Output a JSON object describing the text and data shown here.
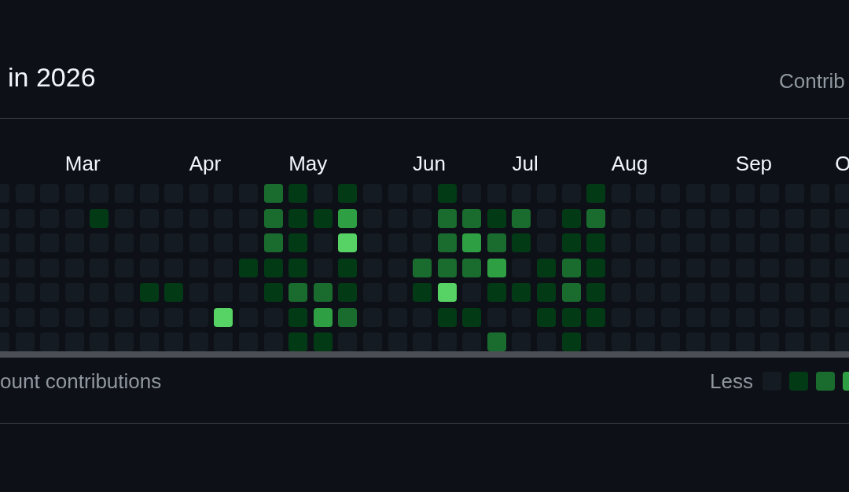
{
  "title": "in 2026",
  "settings_label": "Contrib",
  "weeks": [
    {
      "days": [
        {
          "color": "#151b23"
        },
        {
          "color": "#151b23"
        },
        {
          "color": "#151b23"
        },
        {
          "color": "#151b23"
        },
        {
          "color": "#151b23"
        },
        {
          "color": "#151b23"
        },
        {
          "color": "#151b23"
        }
      ]
    },
    {
      "days": [
        {
          "color": "#151b23"
        },
        {
          "color": "#151b23"
        },
        {
          "color": "#151b23"
        },
        {
          "color": "#151b23"
        },
        {
          "color": "#151b23"
        },
        {
          "color": "#151b23"
        },
        {
          "color": "#151b23"
        }
      ]
    },
    {
      "days": [
        {
          "color": "#151b23"
        },
        {
          "color": "#151b23"
        },
        {
          "color": "#151b23"
        },
        {
          "color": "#151b23"
        },
        {
          "color": "#151b23"
        },
        {
          "color": "#151b23"
        },
        {
          "color": "#151b23"
        }
      ]
    },
    {
      "month": "Mar",
      "days": [
        {
          "color": "#151b23"
        },
        {
          "color": "#151b23"
        },
        {
          "color": "#151b23"
        },
        {
          "color": "#151b23"
        },
        {
          "color": "#151b23"
        },
        {
          "color": "#151b23"
        },
        {
          "color": "#151b23"
        }
      ]
    },
    {
      "days": [
        {
          "color": "#151b23"
        },
        {
          "color": "#033a16"
        },
        {
          "color": "#151b23"
        },
        {
          "color": "#151b23"
        },
        {
          "color": "#151b23"
        },
        {
          "color": "#151b23"
        },
        {
          "color": "#151b23"
        }
      ]
    },
    {
      "days": [
        {
          "color": "#151b23"
        },
        {
          "color": "#151b23"
        },
        {
          "color": "#151b23"
        },
        {
          "color": "#151b23"
        },
        {
          "color": "#151b23"
        },
        {
          "color": "#151b23"
        },
        {
          "color": "#151b23"
        }
      ]
    },
    {
      "days": [
        {
          "color": "#151b23"
        },
        {
          "color": "#151b23"
        },
        {
          "color": "#151b23"
        },
        {
          "color": "#151b23"
        },
        {
          "color": "#033a16"
        },
        {
          "color": "#151b23"
        },
        {
          "color": "#151b23"
        }
      ]
    },
    {
      "days": [
        {
          "color": "#151b23"
        },
        {
          "color": "#151b23"
        },
        {
          "color": "#151b23"
        },
        {
          "color": "#151b23"
        },
        {
          "color": "#033a16"
        },
        {
          "color": "#151b23"
        },
        {
          "color": "#151b23"
        }
      ]
    },
    {
      "month": "Apr",
      "days": [
        {
          "color": "#151b23"
        },
        {
          "color": "#151b23"
        },
        {
          "color": "#151b23"
        },
        {
          "color": "#151b23"
        },
        {
          "color": "#151b23"
        },
        {
          "color": "#151b23"
        },
        {
          "color": "#151b23"
        }
      ]
    },
    {
      "days": [
        {
          "color": "#151b23"
        },
        {
          "color": "#151b23"
        },
        {
          "color": "#151b23"
        },
        {
          "color": "#151b23"
        },
        {
          "color": "#151b23"
        },
        {
          "color": "#56d364"
        },
        {
          "color": "#151b23"
        }
      ]
    },
    {
      "days": [
        {
          "color": "#151b23"
        },
        {
          "color": "#151b23"
        },
        {
          "color": "#151b23"
        },
        {
          "color": "#033a16"
        },
        {
          "color": "#151b23"
        },
        {
          "color": "#151b23"
        },
        {
          "color": "#151b23"
        }
      ]
    },
    {
      "days": [
        {
          "color": "#196c2e"
        },
        {
          "color": "#196c2e"
        },
        {
          "color": "#196c2e"
        },
        {
          "color": "#033a16"
        },
        {
          "color": "#033a16"
        },
        {
          "color": "#151b23"
        },
        {
          "color": "#151b23"
        }
      ]
    },
    {
      "month": "May",
      "days": [
        {
          "color": "#033a16"
        },
        {
          "color": "#033a16"
        },
        {
          "color": "#033a16"
        },
        {
          "color": "#033a16"
        },
        {
          "color": "#196c2e"
        },
        {
          "color": "#033a16"
        },
        {
          "color": "#033a16"
        }
      ]
    },
    {
      "days": [
        {
          "color": "#151b23"
        },
        {
          "color": "#033a16"
        },
        {
          "color": "#151b23"
        },
        {
          "color": "#151b23"
        },
        {
          "color": "#196c2e"
        },
        {
          "color": "#2ea043"
        },
        {
          "color": "#033a16"
        }
      ]
    },
    {
      "days": [
        {
          "color": "#033a16"
        },
        {
          "color": "#2ea043"
        },
        {
          "color": "#56d364"
        },
        {
          "color": "#033a16"
        },
        {
          "color": "#033a16"
        },
        {
          "color": "#196c2e"
        },
        {
          "color": "#151b23"
        }
      ]
    },
    {
      "days": [
        {
          "color": "#151b23"
        },
        {
          "color": "#151b23"
        },
        {
          "color": "#151b23"
        },
        {
          "color": "#151b23"
        },
        {
          "color": "#151b23"
        },
        {
          "color": "#151b23"
        },
        {
          "color": "#151b23"
        }
      ]
    },
    {
      "days": [
        {
          "color": "#151b23"
        },
        {
          "color": "#151b23"
        },
        {
          "color": "#151b23"
        },
        {
          "color": "#151b23"
        },
        {
          "color": "#151b23"
        },
        {
          "color": "#151b23"
        },
        {
          "color": "#151b23"
        }
      ]
    },
    {
      "month": "Jun",
      "days": [
        {
          "color": "#151b23"
        },
        {
          "color": "#151b23"
        },
        {
          "color": "#151b23"
        },
        {
          "color": "#196c2e"
        },
        {
          "color": "#033a16"
        },
        {
          "color": "#151b23"
        },
        {
          "color": "#151b23"
        }
      ]
    },
    {
      "days": [
        {
          "color": "#033a16"
        },
        {
          "color": "#196c2e"
        },
        {
          "color": "#196c2e"
        },
        {
          "color": "#196c2e"
        },
        {
          "color": "#56d364"
        },
        {
          "color": "#033a16"
        },
        {
          "color": "#151b23"
        }
      ]
    },
    {
      "days": [
        {
          "color": "#151b23"
        },
        {
          "color": "#196c2e"
        },
        {
          "color": "#2ea043"
        },
        {
          "color": "#196c2e"
        },
        {
          "color": "#151b23"
        },
        {
          "color": "#033a16"
        },
        {
          "color": "#151b23"
        }
      ]
    },
    {
      "days": [
        {
          "color": "#151b23"
        },
        {
          "color": "#033a16"
        },
        {
          "color": "#196c2e"
        },
        {
          "color": "#2ea043"
        },
        {
          "color": "#033a16"
        },
        {
          "color": "#151b23"
        },
        {
          "color": "#196c2e"
        }
      ]
    },
    {
      "month": "Jul",
      "days": [
        {
          "color": "#151b23"
        },
        {
          "color": "#196c2e"
        },
        {
          "color": "#033a16"
        },
        {
          "color": "#151b23"
        },
        {
          "color": "#033a16"
        },
        {
          "color": "#151b23"
        },
        {
          "color": "#151b23"
        }
      ]
    },
    {
      "days": [
        {
          "color": "#151b23"
        },
        {
          "color": "#151b23"
        },
        {
          "color": "#151b23"
        },
        {
          "color": "#033a16"
        },
        {
          "color": "#033a16"
        },
        {
          "color": "#033a16"
        },
        {
          "color": "#151b23"
        }
      ]
    },
    {
      "days": [
        {
          "color": "#151b23"
        },
        {
          "color": "#033a16"
        },
        {
          "color": "#033a16"
        },
        {
          "color": "#196c2e"
        },
        {
          "color": "#196c2e"
        },
        {
          "color": "#033a16"
        },
        {
          "color": "#033a16"
        }
      ]
    },
    {
      "days": [
        {
          "color": "#033a16"
        },
        {
          "color": "#196c2e"
        },
        {
          "color": "#033a16"
        },
        {
          "color": "#033a16"
        },
        {
          "color": "#033a16"
        },
        {
          "color": "#033a16"
        },
        {
          "color": "#151b23"
        }
      ]
    },
    {
      "month": "Aug",
      "days": [
        {
          "color": "#151b23"
        },
        {
          "color": "#151b23"
        },
        {
          "color": "#151b23"
        },
        {
          "color": "#151b23"
        },
        {
          "color": "#151b23"
        },
        {
          "color": "#151b23"
        },
        {
          "color": "#151b23"
        }
      ]
    },
    {
      "days": [
        {
          "color": "#151b23"
        },
        {
          "color": "#151b23"
        },
        {
          "color": "#151b23"
        },
        {
          "color": "#151b23"
        },
        {
          "color": "#151b23"
        },
        {
          "color": "#151b23"
        },
        {
          "color": "#151b23"
        }
      ]
    },
    {
      "days": [
        {
          "color": "#151b23"
        },
        {
          "color": "#151b23"
        },
        {
          "color": "#151b23"
        },
        {
          "color": "#151b23"
        },
        {
          "color": "#151b23"
        },
        {
          "color": "#151b23"
        },
        {
          "color": "#151b23"
        }
      ]
    },
    {
      "days": [
        {
          "color": "#151b23"
        },
        {
          "color": "#151b23"
        },
        {
          "color": "#151b23"
        },
        {
          "color": "#151b23"
        },
        {
          "color": "#151b23"
        },
        {
          "color": "#151b23"
        },
        {
          "color": "#151b23"
        }
      ]
    },
    {
      "days": [
        {
          "color": "#151b23"
        },
        {
          "color": "#151b23"
        },
        {
          "color": "#151b23"
        },
        {
          "color": "#151b23"
        },
        {
          "color": "#151b23"
        },
        {
          "color": "#151b23"
        },
        {
          "color": "#151b23"
        }
      ]
    },
    {
      "month": "Sep",
      "days": [
        {
          "color": "#151b23"
        },
        {
          "color": "#151b23"
        },
        {
          "color": "#151b23"
        },
        {
          "color": "#151b23"
        },
        {
          "color": "#151b23"
        },
        {
          "color": "#151b23"
        },
        {
          "color": "#151b23"
        }
      ]
    },
    {
      "days": [
        {
          "color": "#151b23"
        },
        {
          "color": "#151b23"
        },
        {
          "color": "#151b23"
        },
        {
          "color": "#151b23"
        },
        {
          "color": "#151b23"
        },
        {
          "color": "#151b23"
        },
        {
          "color": "#151b23"
        }
      ]
    },
    {
      "days": [
        {
          "color": "#151b23"
        },
        {
          "color": "#151b23"
        },
        {
          "color": "#151b23"
        },
        {
          "color": "#151b23"
        },
        {
          "color": "#151b23"
        },
        {
          "color": "#151b23"
        },
        {
          "color": "#151b23"
        }
      ]
    },
    {
      "days": [
        {
          "color": "#151b23"
        },
        {
          "color": "#151b23"
        },
        {
          "color": "#151b23"
        },
        {
          "color": "#151b23"
        },
        {
          "color": "#151b23"
        },
        {
          "color": "#151b23"
        },
        {
          "color": "#151b23"
        }
      ]
    },
    {
      "month": "O",
      "days": [
        {
          "color": "#151b23"
        },
        {
          "color": "#151b23"
        },
        {
          "color": "#151b23"
        },
        {
          "color": "#151b23"
        },
        {
          "color": "#151b23"
        },
        {
          "color": "#151b23"
        },
        {
          "color": "#151b23"
        }
      ]
    }
  ],
  "footer_note": "ount contributions",
  "legend": {
    "less_label": "Less",
    "swatches": [
      {
        "color": "#151b23"
      },
      {
        "color": "#033a16"
      },
      {
        "color": "#196c2e"
      },
      {
        "color": "#2ea043"
      }
    ]
  }
}
